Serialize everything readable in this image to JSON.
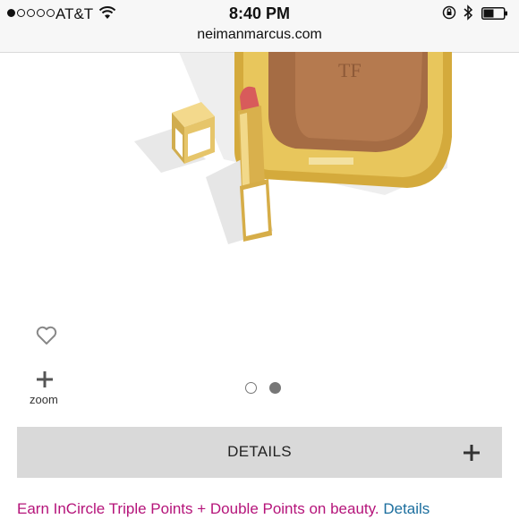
{
  "status_bar": {
    "carrier": "AT&T",
    "time": "8:40 PM",
    "signal_bars_filled": 1,
    "signal_bars_total": 5
  },
  "browser": {
    "url": "neimanmarcus.com"
  },
  "product": {
    "image_alt_icon": "product-photo-lipstick-bronzer"
  },
  "actions": {
    "favorite_icon": "heart-icon",
    "zoom_icon": "plus-icon",
    "zoom_label": "zoom"
  },
  "pager": {
    "current": 2,
    "total": 2
  },
  "details": {
    "label": "DETAILS",
    "expand_icon": "plus-icon"
  },
  "promo": {
    "text": "Earn InCircle Triple Points + Double Points on beauty.",
    "link_label": "Details"
  },
  "colors": {
    "promo_text": "#b5147a",
    "promo_link": "#1b6e9e",
    "details_bar_bg": "#d9d9d9"
  }
}
